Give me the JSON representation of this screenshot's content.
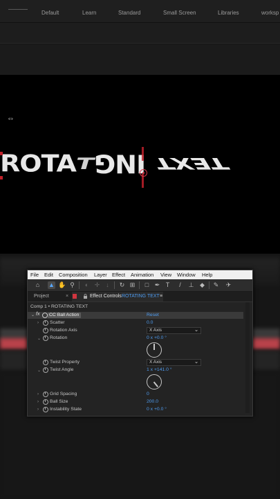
{
  "workspace_bar": {
    "tabs": [
      "Default",
      "Learn",
      "Standard",
      "Small Screen",
      "Libraries",
      "worksp"
    ]
  },
  "viewer": {
    "composition_text": {
      "part1": "ROTA",
      "part2": "T",
      "part3": "ING",
      "part4": "TEXT"
    }
  },
  "menu": [
    "File",
    "Edit",
    "Composition",
    "Layer",
    "Effect",
    "Animation",
    "View",
    "Window",
    "Help"
  ],
  "toolbar": {
    "tools": [
      {
        "icon": "home-icon",
        "glyph": "⌂"
      },
      {
        "icon": "selection-tool-icon",
        "glyph": "▲"
      },
      {
        "icon": "hand-tool-icon",
        "glyph": "✋"
      },
      {
        "icon": "zoom-tool-icon",
        "glyph": "⚲"
      },
      {
        "icon": "orbit-tool-icon",
        "glyph": "◐"
      },
      {
        "icon": "pan-tool-icon",
        "glyph": "✛"
      },
      {
        "icon": "dolly-tool-icon",
        "glyph": "↓"
      },
      {
        "icon": "rotation-tool-icon",
        "glyph": "↻"
      },
      {
        "icon": "pan-behind-tool-icon",
        "glyph": "⊞"
      },
      {
        "icon": "rectangle-tool-icon",
        "glyph": "□"
      },
      {
        "icon": "pen-tool-icon",
        "glyph": "✒"
      },
      {
        "icon": "type-tool-icon",
        "glyph": "T"
      },
      {
        "icon": "brush-tool-icon",
        "glyph": "/"
      },
      {
        "icon": "clone-stamp-tool-icon",
        "glyph": "⊥"
      },
      {
        "icon": "eraser-tool-icon",
        "glyph": "◆"
      },
      {
        "icon": "roto-brush-tool-icon",
        "glyph": "✎"
      },
      {
        "icon": "puppet-pin-tool-icon",
        "glyph": "✈"
      }
    ]
  },
  "tabs": {
    "project": "Project",
    "close": "×",
    "effect_controls": "Effect Controls",
    "layer_name": "ROTATING TEXT",
    "menu_glyph": "≡"
  },
  "breadcrumb": "Comp 1 • ROTATING TEXT",
  "effect": {
    "fx": "fx",
    "name": "CC Ball Action",
    "reset": "Reset"
  },
  "params": {
    "scatter": {
      "name": "Scatter",
      "value": "0.0"
    },
    "rotation_axis": {
      "name": "Rotation Axis",
      "value": "X Axis"
    },
    "rotation": {
      "name": "Rotation",
      "value": "0 x +0.0 °"
    },
    "twist_property": {
      "name": "Twist Property",
      "value": "X Axis"
    },
    "twist_angle": {
      "name": "Twist Angle",
      "value": "1 x +141.0 °"
    },
    "grid_spacing": {
      "name": "Grid Spacing",
      "value": "0"
    },
    "ball_size": {
      "name": "Ball Size",
      "value": "200.0"
    },
    "instability_state": {
      "name": "Instability State",
      "value": "0 x +0.0 °"
    }
  },
  "colors": {
    "accent_blue": "#4f9cf0",
    "red": "#d0353f",
    "panel_bg": "#232323"
  }
}
